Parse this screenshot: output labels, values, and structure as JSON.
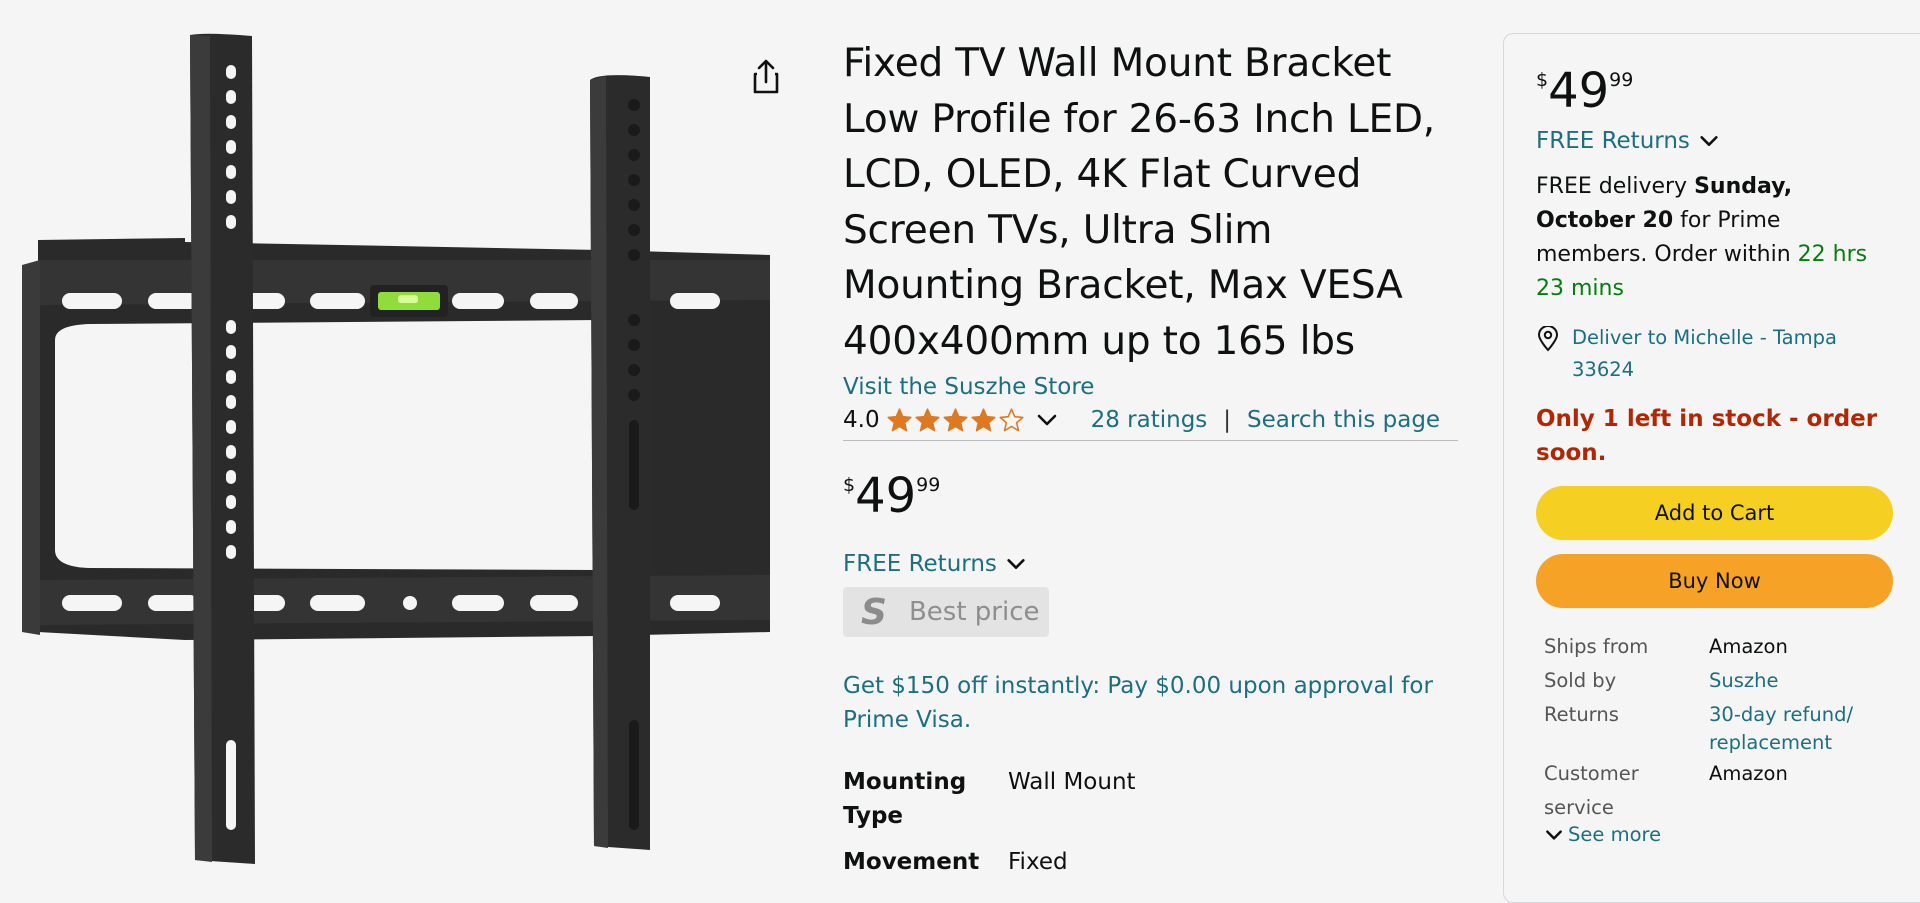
{
  "product": {
    "title": "Fixed TV Wall Mount Bracket Low Profile for 26-63 Inch LED, LCD, OLED, 4K Flat Curved Screen TVs, Ultra Slim Mounting Bracket, Max VESA 400x400mm up to 165 lbs",
    "store_link": "Visit the Suszhe Store",
    "rating_value": "4.0",
    "rating_stars": 4,
    "rating_max": 5,
    "ratings_count": "28 ratings",
    "rating_separator": "|",
    "search_page": "Search this page",
    "image_icon": "tv-wall-mount-bracket-image",
    "share_icon": "share-icon"
  },
  "price": {
    "currency": "$",
    "whole": "49",
    "fraction": "99"
  },
  "returns_label": "FREE Returns",
  "badge": {
    "logo": "S",
    "text": "Best price"
  },
  "promo": "Get $150 off instantly: Pay $0.00 upon approval for Prime Visa.",
  "specs": [
    {
      "key": "Mounting Type",
      "value": "Wall Mount"
    },
    {
      "key": "Movement",
      "value": "Fixed"
    }
  ],
  "buybox": {
    "delivery_prefix": "FREE delivery ",
    "delivery_date": "Sunday, October 20",
    "delivery_mid": " for Prime members. Order within ",
    "countdown": "22 hrs 23 mins",
    "deliver_to": "Deliver to Michelle - Tampa 33624",
    "stock": "Only 1 left in stock - order soon.",
    "add_to_cart": "Add to Cart",
    "buy_now": "Buy Now",
    "info": [
      {
        "key": "Ships from",
        "value": "Amazon",
        "link": false
      },
      {
        "key": "Sold by",
        "value": "Suszhe",
        "link": true
      },
      {
        "key": "Returns",
        "value": "30-day refund/ replacement",
        "link": true
      },
      {
        "key": "Customer service",
        "value": "Amazon",
        "link": false
      }
    ],
    "see_more": "See more"
  },
  "colors": {
    "link": "#1d6f7f",
    "star": "#de7921",
    "stock": "#b12704",
    "countdown": "#067d0e",
    "add_to_cart": "#f5d022",
    "buy_now": "#f5a226"
  }
}
